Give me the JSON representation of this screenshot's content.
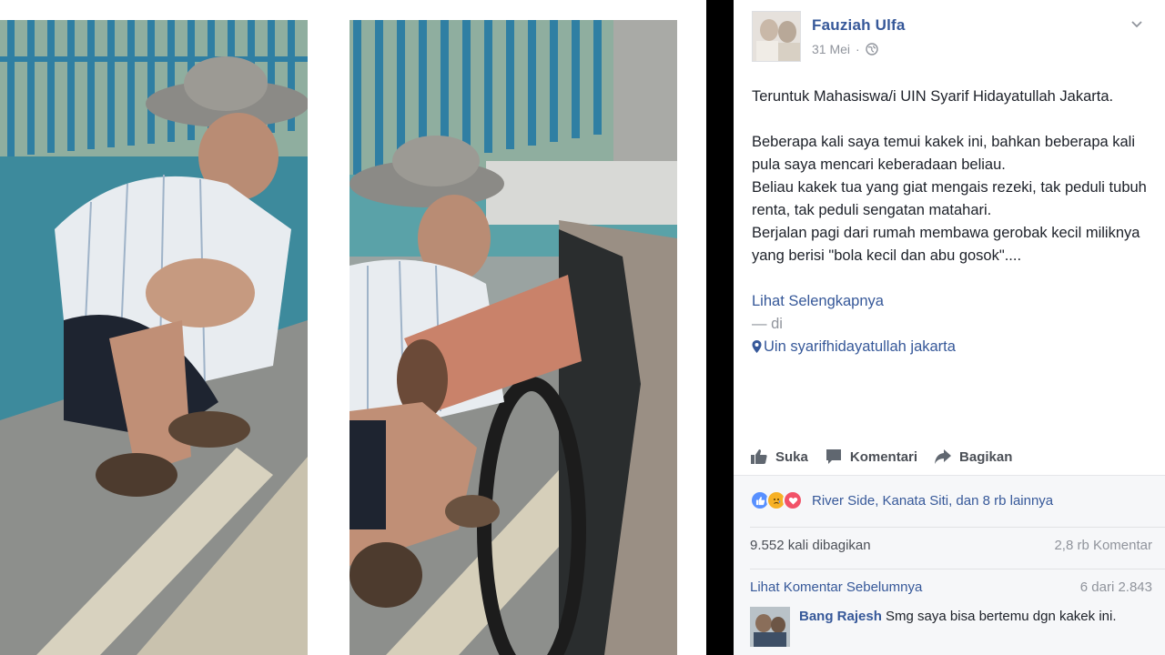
{
  "post": {
    "author": "Fauziah Ulfa",
    "date": "31 Mei",
    "body_line1": "Teruntuk Mahasiswa/i UIN Syarif Hidayatullah Jakarta.",
    "body_line2": "Beberapa kali saya temui kakek ini, bahkan beberapa kali pula saya mencari keberadaan beliau.",
    "body_line3": "Beliau kakek tua yang giat mengais rezeki, tak peduli tubuh renta, tak peduli sengatan matahari.",
    "body_line4": "Berjalan pagi dari rumah membawa gerobak kecil miliknya yang berisi \"bola kecil dan abu gosok\"....",
    "see_more": "Lihat Selengkapnya",
    "location_separator": "— di",
    "location": "Uin syarifhidayatullah jakarta"
  },
  "actions": {
    "like": "Suka",
    "comment": "Komentari",
    "share": "Bagikan"
  },
  "feedback": {
    "reactions_text": "River Side, Kanata Siti, dan 8 rb lainnya",
    "shares": "9.552 kali dibagikan",
    "comments_count": "2,8 rb Komentar",
    "previous_comments": "Lihat Komentar Sebelumnya",
    "pagination": "6 dari 2.843",
    "comment": {
      "author": "Bang Rajesh",
      "text": "Smg saya bisa bertemu dgn kakek ini."
    }
  },
  "icons": {
    "reaction_like": "like-reaction-icon",
    "reaction_sad": "sad-reaction-icon",
    "reaction_love": "love-reaction-icon",
    "privacy": "globe-icon",
    "options": "chevron-down-icon",
    "location": "location-pin-icon"
  },
  "colors": {
    "link": "#365899",
    "secondary_text": "#90949c",
    "feedback_bg": "#f6f7f9",
    "like_blue": "#5890ff",
    "love_red": "#f25268",
    "sad_yellow": "#f7b125"
  }
}
